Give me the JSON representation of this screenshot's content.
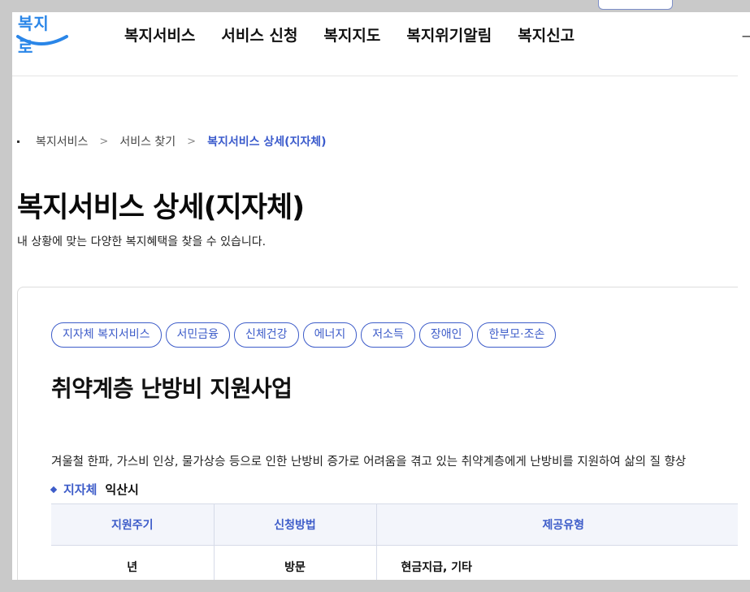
{
  "logo": {
    "text": "복지로"
  },
  "nav": {
    "items": [
      {
        "label": "복지서비스"
      },
      {
        "label": "서비스 신청"
      },
      {
        "label": "복지지도"
      },
      {
        "label": "복지위기알림"
      },
      {
        "label": "복지신고"
      }
    ]
  },
  "breadcrumb": {
    "items": [
      {
        "label": "복지서비스"
      },
      {
        "label": "서비스 찾기"
      },
      {
        "label": "복지서비스 상세(지자체)"
      }
    ],
    "separator": ">"
  },
  "page": {
    "title": "복지서비스 상세(지자체)",
    "subtitle": "내 상황에 맞는 다양한 복지혜택을 찾을 수 있습니다."
  },
  "service": {
    "tags": [
      {
        "label": "지자체 복지서비스"
      },
      {
        "label": "서민금융"
      },
      {
        "label": "신체건강"
      },
      {
        "label": "에너지"
      },
      {
        "label": "저소득"
      },
      {
        "label": "장애인"
      },
      {
        "label": "한부모·조손"
      }
    ],
    "title": "취약계층 난방비 지원사업",
    "description": "겨울철 한파, 가스비 인상, 물가상승 등으로 인한 난방비 증가로 어려움을 겪고 있는 취약계층에게 난방비를 지원하여 삶의 질 향상",
    "region_label": "지자체",
    "region_value": "익산시",
    "table": {
      "headers": [
        "지원주기",
        "신청방법",
        "제공유형"
      ],
      "row": [
        "년",
        "방문",
        "현금지급, 기타"
      ]
    }
  },
  "colors": {
    "accent": "#3d5cc9",
    "logo": "#2a86e8"
  }
}
